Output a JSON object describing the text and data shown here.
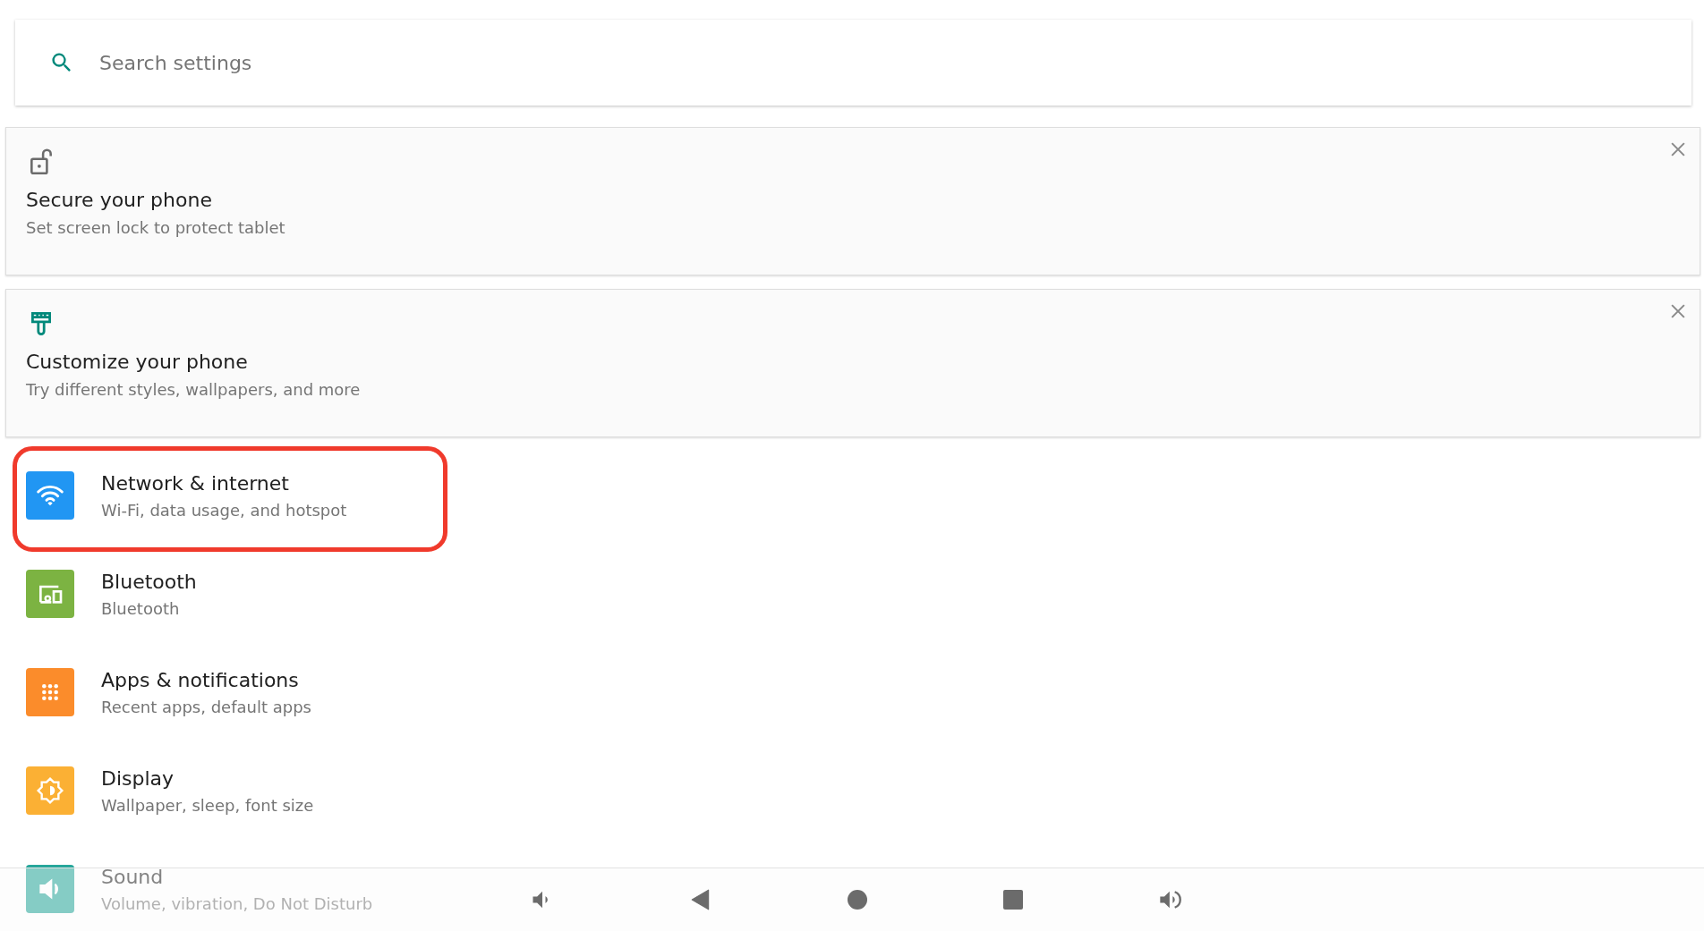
{
  "search": {
    "placeholder": "Search settings"
  },
  "suggestions": [
    {
      "kind": "lock",
      "title": "Secure your phone",
      "summary": "Set screen lock to protect tablet"
    },
    {
      "kind": "brush",
      "title": "Customize your phone",
      "summary": "Try different styles, wallpapers, and more"
    }
  ],
  "settings": [
    {
      "kind": "wifi",
      "color": "#2196f3",
      "title": "Network & internet",
      "summary": "Wi-Fi, data usage, and hotspot",
      "highlighted": true
    },
    {
      "kind": "devices",
      "color": "#7cb342",
      "title": "Bluetooth",
      "summary": "Bluetooth",
      "highlighted": false
    },
    {
      "kind": "apps",
      "color": "#fb8c2b",
      "title": "Apps & notifications",
      "summary": "Recent apps, default apps",
      "highlighted": false
    },
    {
      "kind": "display",
      "color": "#fbb034",
      "title": "Display",
      "summary": "Wallpaper, sleep, font size",
      "highlighted": false
    },
    {
      "kind": "sound",
      "color": "#26a69a",
      "title": "Sound",
      "summary": "Volume, vibration, Do Not Disturb",
      "highlighted": false
    }
  ],
  "nav_bar": [
    {
      "kind": "volume-down"
    },
    {
      "kind": "back"
    },
    {
      "kind": "home"
    },
    {
      "kind": "recents"
    },
    {
      "kind": "volume-up"
    }
  ]
}
